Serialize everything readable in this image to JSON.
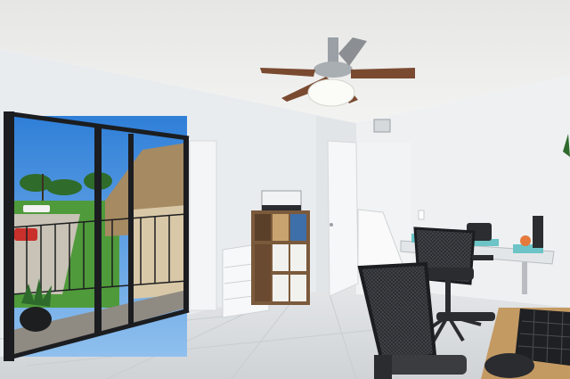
{
  "scene": {
    "kind": "photo",
    "subject": "home-office-bedroom",
    "colors": {
      "ceiling": "#ececeb",
      "wall": "#ebeef0",
      "floor": "#d9dcde",
      "sky": "#3f8fe0",
      "grass": "#4f9a3b",
      "door_frame": "#1b1d20",
      "fan_blade": "#7a4a30",
      "shelf_wood": "#7b5a3c",
      "chair_mesh": "#2a2c30",
      "desk_wood": "#c49a63"
    }
  }
}
